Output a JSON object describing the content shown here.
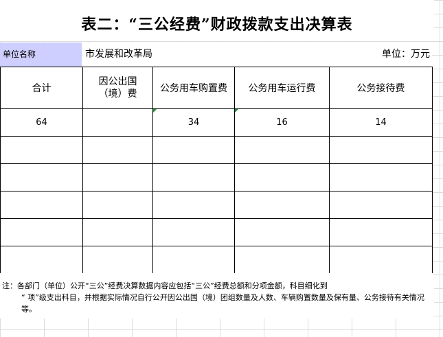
{
  "title": "表二：“三公经费”财政拨款支出决算表",
  "unit_label": "单位名称",
  "unit_value": "市发展和改革局",
  "currency": "单位：万元",
  "headers": [
    "合计",
    "因公出国（境）费",
    "公务用车购置费",
    "公务用车运行费",
    "公务接待费"
  ],
  "row": [
    "64",
    "",
    "34",
    "16",
    "14"
  ],
  "note_line1": "注：各部门（单位）公开“三公”经费决算数据内容应包括“三公”经费总额和分项金额，科目细化到",
  "note_line2": "“ 项”级支出科目，并根据实际情况自行公开因公出国（境）团组数量及人数、车辆购置数量及保有量、公务接待有关情况等。"
}
